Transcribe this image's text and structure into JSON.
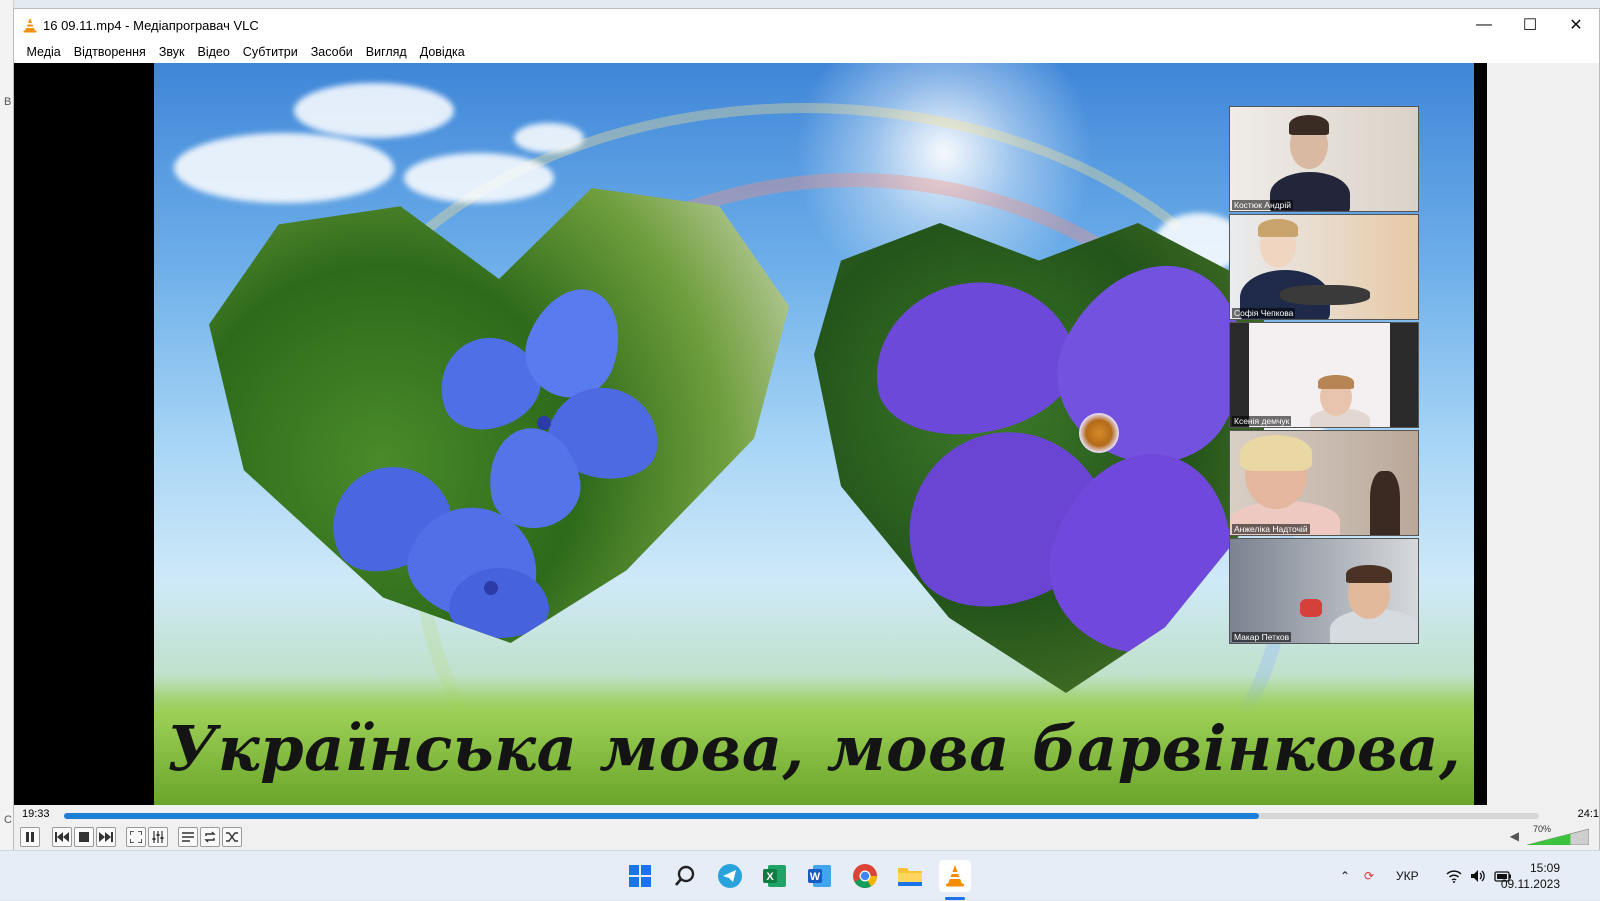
{
  "window": {
    "title": "16 09.11.mp4 - Медіапрогравач VLC",
    "minimize": "—",
    "maximize": "☐",
    "close": "✕"
  },
  "menu": [
    "Медіа",
    "Відтворення",
    "Звук",
    "Відео",
    "Субтитри",
    "Засоби",
    "Вигляд",
    "Довідка"
  ],
  "video": {
    "caption": "Українська мова, мова барвінкова,"
  },
  "participants": [
    {
      "name": "Костюк Андрій"
    },
    {
      "name": "Софія Чепкова"
    },
    {
      "name": "Ксенія демчук"
    },
    {
      "name": "Анжеліка Надточій"
    },
    {
      "name": "Макар Петков"
    }
  ],
  "playback": {
    "current_time": "19:33",
    "total_time": "24:1",
    "progress": 0.81,
    "volume_label": "70%",
    "volume": 0.7
  },
  "background_window": {
    "letters": [
      "B",
      "C"
    ]
  },
  "taskbar": {
    "language": "УКР",
    "time": "15:09",
    "date": "09.11.2023",
    "apps": [
      "start-icon",
      "search-icon",
      "telegram-icon",
      "excel-icon",
      "word-icon",
      "chrome-icon",
      "file-explorer-icon",
      "vlc-icon"
    ]
  }
}
